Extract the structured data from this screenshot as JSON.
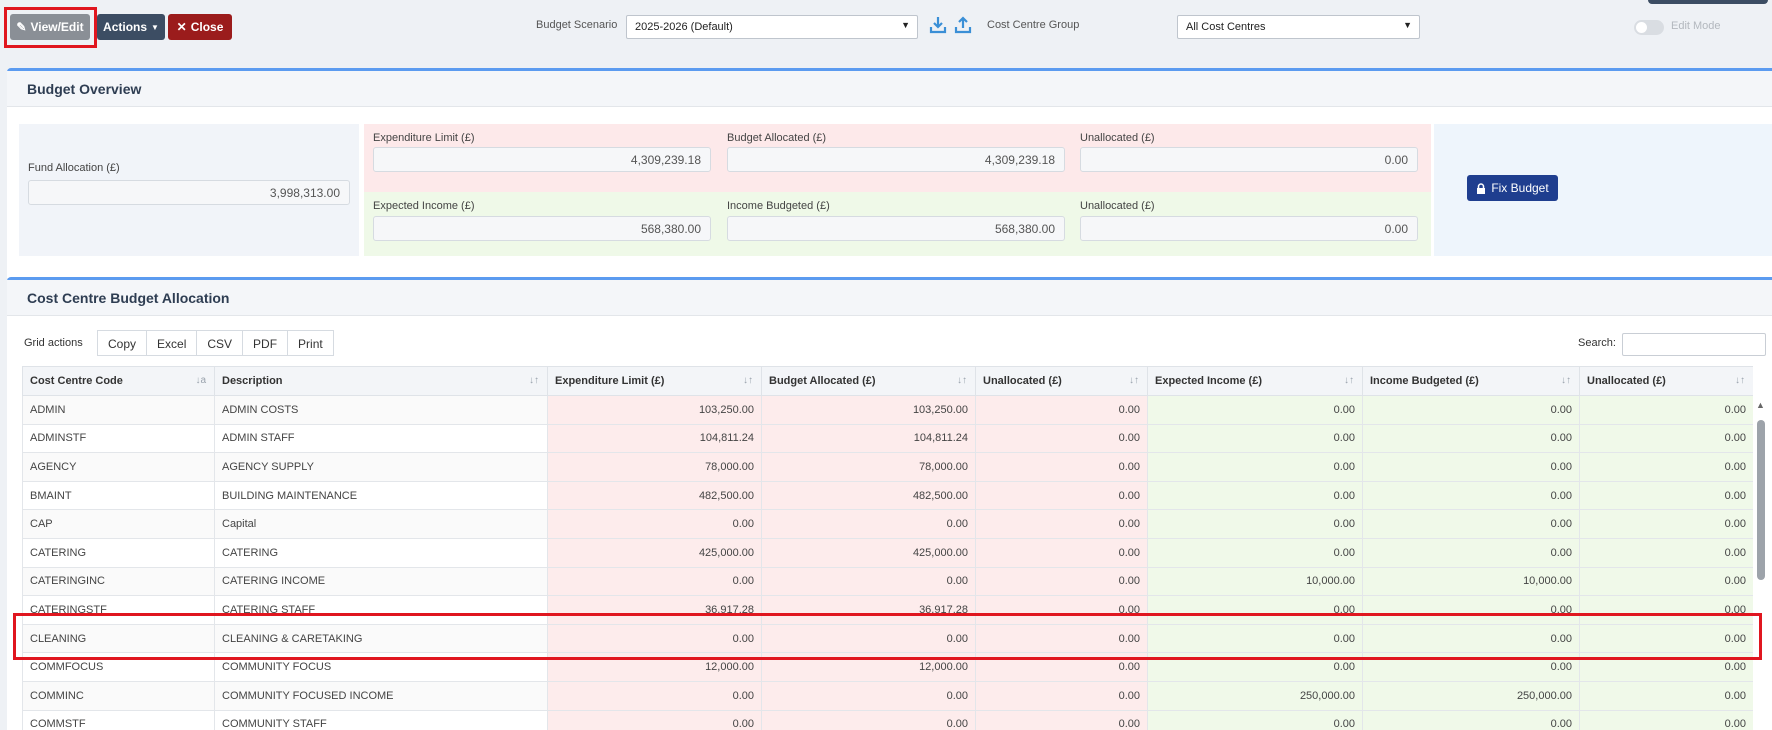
{
  "toolbar": {
    "view_edit_label": "View/Edit",
    "actions_label": "Actions",
    "close_label": "Close",
    "budget_scenario_label": "Budget Scenario",
    "budget_scenario_value": "2025-2026 (Default)",
    "cost_centre_group_label": "Cost Centre Group",
    "cost_centre_group_value": "All Cost Centres",
    "edit_mode_label": "Edit Mode",
    "edit_mode_on": false
  },
  "overview": {
    "title": "Budget Overview",
    "fund_allocation_label": "Fund Allocation (£)",
    "fund_allocation_value": "3,998,313.00",
    "expenditure_limit_label": "Expenditure Limit (£)",
    "expenditure_limit_value": "4,309,239.18",
    "budget_allocated_label": "Budget Allocated (£)",
    "budget_allocated_value": "4,309,239.18",
    "unallocated_exp_label": "Unallocated (£)",
    "unallocated_exp_value": "0.00",
    "expected_income_label": "Expected Income (£)",
    "expected_income_value": "568,380.00",
    "income_budgeted_label": "Income Budgeted (£)",
    "income_budgeted_value": "568,380.00",
    "unallocated_inc_label": "Unallocated (£)",
    "unallocated_inc_value": "0.00",
    "fix_budget_label": "Fix Budget"
  },
  "allocation": {
    "title": "Cost Centre Budget Allocation",
    "grid_actions_label": "Grid actions",
    "grid_buttons": [
      "Copy",
      "Excel",
      "CSV",
      "PDF",
      "Print"
    ],
    "search_label": "Search:",
    "columns": [
      "Cost Centre Code",
      "Description",
      "Expenditure Limit (£)",
      "Budget Allocated (£)",
      "Unallocated (£)",
      "Expected Income (£)",
      "Income Budgeted (£)",
      "Unallocated (£)"
    ],
    "rows": [
      [
        "ADMIN",
        "ADMIN COSTS",
        "103,250.00",
        "103,250.00",
        "0.00",
        "0.00",
        "0.00",
        "0.00"
      ],
      [
        "ADMINSTF",
        "ADMIN STAFF",
        "104,811.24",
        "104,811.24",
        "0.00",
        "0.00",
        "0.00",
        "0.00"
      ],
      [
        "AGENCY",
        "AGENCY SUPPLY",
        "78,000.00",
        "78,000.00",
        "0.00",
        "0.00",
        "0.00",
        "0.00"
      ],
      [
        "BMAINT",
        "BUILDING MAINTENANCE",
        "482,500.00",
        "482,500.00",
        "0.00",
        "0.00",
        "0.00",
        "0.00"
      ],
      [
        "CAP",
        "Capital",
        "0.00",
        "0.00",
        "0.00",
        "0.00",
        "0.00",
        "0.00"
      ],
      [
        "CATERING",
        "CATERING",
        "425,000.00",
        "425,000.00",
        "0.00",
        "0.00",
        "0.00",
        "0.00"
      ],
      [
        "CATERINGINC",
        "CATERING INCOME",
        "0.00",
        "0.00",
        "0.00",
        "10,000.00",
        "10,000.00",
        "0.00"
      ],
      [
        "CATERINGSTF",
        "CATERING STAFF",
        "36,917.28",
        "36,917.28",
        "0.00",
        "0.00",
        "0.00",
        "0.00"
      ],
      [
        "CLEANING",
        "CLEANING & CARETAKING",
        "0.00",
        "0.00",
        "0.00",
        "0.00",
        "0.00",
        "0.00"
      ],
      [
        "COMMFOCUS",
        "COMMUNITY FOCUS",
        "12,000.00",
        "12,000.00",
        "0.00",
        "0.00",
        "0.00",
        "0.00"
      ],
      [
        "COMMINC",
        "COMMUNITY FOCUSED INCOME",
        "0.00",
        "0.00",
        "0.00",
        "250,000.00",
        "250,000.00",
        "0.00"
      ],
      [
        "COMMSTF",
        "COMMUNITY STAFF",
        "0.00",
        "0.00",
        "0.00",
        "0.00",
        "0.00",
        "0.00"
      ]
    ]
  }
}
